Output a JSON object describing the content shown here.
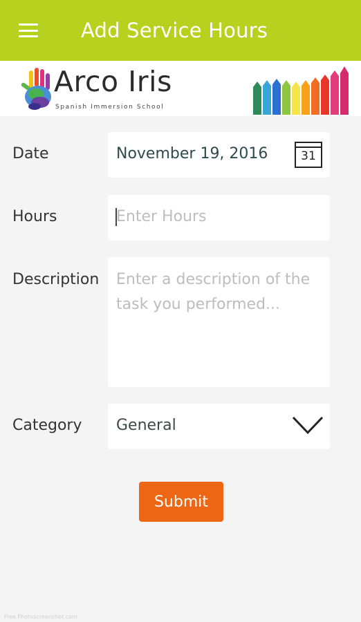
{
  "appbar": {
    "title": "Add Service Hours",
    "menu_icon": "hamburger-menu-icon",
    "background_color": "#b6d21f"
  },
  "banner": {
    "logo_title": "Arco Iris",
    "logo_subtitle": "Spanish Immersion School",
    "hand_icon": "rainbow-hand-icon",
    "pencils_image": "colored-pencils-image"
  },
  "form": {
    "date": {
      "label": "Date",
      "value": "November 19, 2016",
      "calendar_icon": "calendar-icon",
      "calendar_day": "31"
    },
    "hours": {
      "label": "Hours",
      "placeholder": "Enter Hours"
    },
    "description": {
      "label": "Description",
      "placeholder_line1": "Enter a description of the",
      "placeholder_line2": "task you performed..."
    },
    "category": {
      "label": "Category",
      "selected": "General",
      "dropdown_icon": "chevron-down-icon"
    },
    "submit_label": "Submit",
    "submit_color": "#ec6614"
  },
  "footer": {
    "watermark": "Free Photoscreenshot.com"
  }
}
